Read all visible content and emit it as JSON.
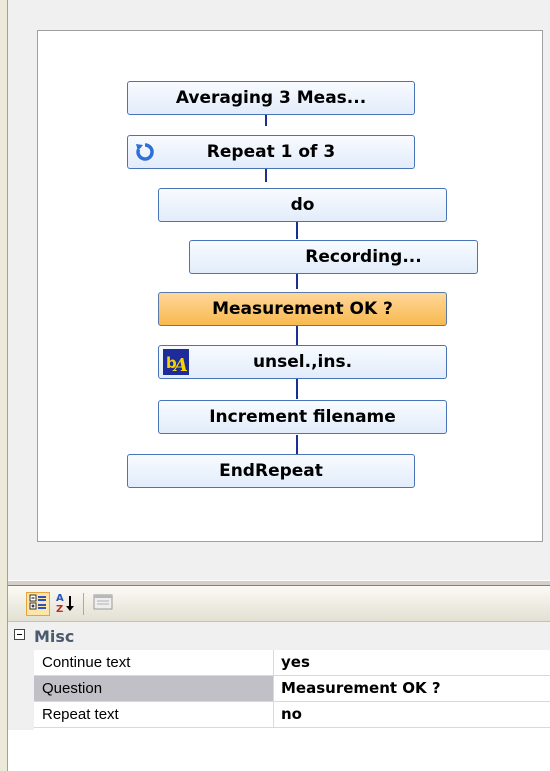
{
  "flowchart": {
    "nodes": [
      {
        "label": "Averaging 3 Meas...",
        "icon": null,
        "selected": false
      },
      {
        "label": "Repeat 1 of 3",
        "icon": "repeat-icon",
        "selected": false
      },
      {
        "label": "do",
        "icon": null,
        "selected": false
      },
      {
        "label": "Recording...",
        "icon": null,
        "selected": false
      },
      {
        "label": "Measurement OK ?",
        "icon": null,
        "selected": true
      },
      {
        "label": "unsel.,ins.",
        "icon": "text-replace-icon",
        "selected": false
      },
      {
        "label": "Increment filename",
        "icon": null,
        "selected": false
      },
      {
        "label": "EndRepeat",
        "icon": null,
        "selected": false
      }
    ]
  },
  "toolbar": {
    "buttons": [
      {
        "icon": "categorized-icon",
        "active": true
      },
      {
        "icon": "sort-alphabetical-icon",
        "active": false
      },
      {
        "icon": "property-pages-icon",
        "active": false
      }
    ]
  },
  "properties": {
    "category": "Misc",
    "rows": [
      {
        "name": "Continue text",
        "value": "yes",
        "selected": false
      },
      {
        "name": "Question",
        "value": "Measurement OK ?",
        "selected": true
      },
      {
        "name": "Repeat text",
        "value": "no",
        "selected": false
      }
    ]
  },
  "colors": {
    "node_border": "#4a74b8",
    "node_selected": "#f8b94e",
    "connector": "#1a2f8f"
  }
}
